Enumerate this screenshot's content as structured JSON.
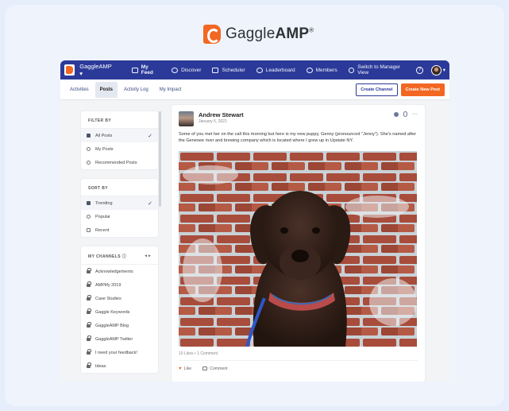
{
  "brand": {
    "name_light": "Gaggle",
    "name_bold": "AMP",
    "mark": "®"
  },
  "topbar": {
    "app_name": "GaggleAMP ▾",
    "nav": [
      {
        "label": "My Feed",
        "icon": "monitor-icon",
        "active": true
      },
      {
        "label": "Discover",
        "icon": "compass-icon",
        "active": false
      },
      {
        "label": "Scheduler",
        "icon": "calendar-icon",
        "active": false
      },
      {
        "label": "Leaderboard",
        "icon": "trophy-icon",
        "active": false
      },
      {
        "label": "Members",
        "icon": "members-icon",
        "active": false
      }
    ],
    "switch_label": "Switch to Manager View",
    "help_glyph": "?",
    "avatar_caret": "▾"
  },
  "subbar": {
    "tabs": [
      {
        "label": "Activities",
        "active": false
      },
      {
        "label": "Posts",
        "active": true
      },
      {
        "label": "Activity Log",
        "active": false
      },
      {
        "label": "My Impact",
        "active": false
      }
    ],
    "create_channel": "Create Channel",
    "create_post": "Create New Post"
  },
  "filter": {
    "title": "FILTER BY",
    "items": [
      {
        "label": "All Posts",
        "selected": true
      },
      {
        "label": "My Posts",
        "selected": false
      },
      {
        "label": "Recommended Posts",
        "selected": false
      }
    ]
  },
  "sort": {
    "title": "SORT BY",
    "items": [
      {
        "label": "Trending",
        "selected": true
      },
      {
        "label": "Popular",
        "selected": false
      },
      {
        "label": "Recent",
        "selected": false
      }
    ]
  },
  "channels": {
    "title": "MY CHANNELS ⓘ",
    "arrows": "◂ ▸",
    "items": [
      "Acknowledgements",
      "AMPlify 2019",
      "Case Studies",
      "Gaggle Keywords",
      "GaggleAMP Blog",
      "GaggleAMP Twitter",
      "I need your feedback!",
      "Ideas"
    ]
  },
  "post": {
    "author": "Andrew Stewart",
    "date": "January 5, 2021",
    "text": "Some of you met her on the call this morning but here is my new puppy, Genny (pronounced \"Jenny\"). She's named after the Genesee river and brewing company which is located where I grew up in Upstate NY.",
    "meta": "10 Likes • 1 Comment",
    "like": "Like",
    "comment": "Comment",
    "more": "···"
  },
  "colors": {
    "nav_bg": "#2b3a99",
    "accent": "#f26722"
  }
}
